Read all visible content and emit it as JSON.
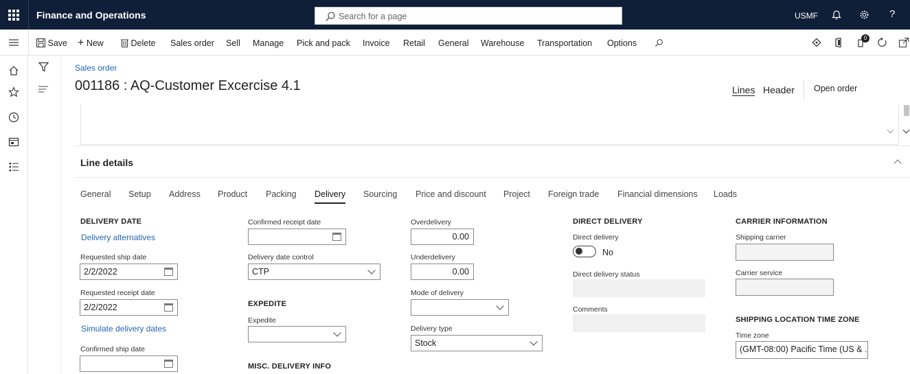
{
  "topbar": {
    "app_title": "Finance and Operations",
    "search_placeholder": "Search for a page",
    "company": "USMF",
    "help": "?"
  },
  "cmdbar": {
    "save": "Save",
    "new": "New",
    "delete": "Delete",
    "items": [
      "Sales order",
      "Sell",
      "Manage",
      "Pick and pack",
      "Invoice",
      "Retail",
      "General",
      "Warehouse",
      "Transportation",
      "Options"
    ],
    "notification_count": "0"
  },
  "page": {
    "breadcrumb": "Sales order",
    "title": "001186 : AQ-Customer Excercise 4.1",
    "view_lines": "Lines",
    "view_header": "Header",
    "open_order": "Open order"
  },
  "line_details": {
    "title": "Line details",
    "tabs": [
      "General",
      "Setup",
      "Address",
      "Product",
      "Packing",
      "Delivery",
      "Sourcing",
      "Price and discount",
      "Project",
      "Foreign trade",
      "Financial dimensions",
      "Loads"
    ],
    "active_tab": "Delivery"
  },
  "delivery_date": {
    "group": "DELIVERY DATE",
    "alternatives_link": "Delivery alternatives",
    "requested_ship_label": "Requested ship date",
    "requested_ship_value": "2/2/2022",
    "requested_receipt_label": "Requested receipt date",
    "requested_receipt_value": "2/2/2022",
    "simulate_link": "Simulate delivery dates",
    "confirmed_ship_label": "Confirmed ship date",
    "confirmed_ship_value": ""
  },
  "col2": {
    "confirmed_receipt_label": "Confirmed receipt date",
    "confirmed_receipt_value": "",
    "date_control_label": "Delivery date control",
    "date_control_value": "CTP",
    "expedite_group": "EXPEDITE",
    "expedite_label": "Expedite",
    "expedite_value": "",
    "misc_group": "MISC. DELIVERY INFO"
  },
  "col3": {
    "overdelivery_label": "Overdelivery",
    "overdelivery_value": "0.00",
    "underdelivery_label": "Underdelivery",
    "underdelivery_value": "0.00",
    "mode_label": "Mode of delivery",
    "mode_value": "",
    "type_label": "Delivery type",
    "type_value": "Stock"
  },
  "direct_delivery": {
    "group": "DIRECT DELIVERY",
    "toggle_label": "Direct delivery",
    "toggle_value": "No",
    "status_label": "Direct delivery status",
    "comments_label": "Comments"
  },
  "carrier": {
    "group": "CARRIER INFORMATION",
    "shipping_carrier_label": "Shipping carrier",
    "carrier_service_label": "Carrier service",
    "tz_group": "SHIPPING LOCATION TIME ZONE",
    "tz_label": "Time zone",
    "tz_value": "(GMT-08:00) Pacific Time (US & ..."
  }
}
